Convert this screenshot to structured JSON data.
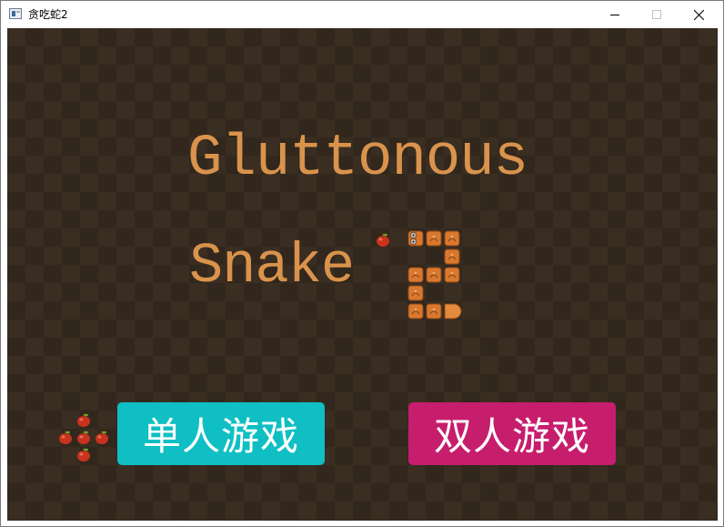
{
  "window": {
    "title": "贪吃蛇2",
    "controls": {
      "minimize": "minimize",
      "maximize": "maximize",
      "close": "close"
    }
  },
  "game": {
    "title_line1": "Gluttonous",
    "title_line2": "Snake",
    "buttons": {
      "single_player": "单人游戏",
      "two_player": "双人游戏"
    },
    "colors": {
      "background": "#3a2d21",
      "title": "#d9934c",
      "single_button": "#0fbfc3",
      "two_player_button": "#c61d6d",
      "snake": "#d9782e",
      "apple": "#c8321e"
    },
    "icons": [
      "apple-icon",
      "snake-head-icon",
      "snake-body-icon",
      "snake-tail-icon",
      "window-app-icon"
    ]
  }
}
